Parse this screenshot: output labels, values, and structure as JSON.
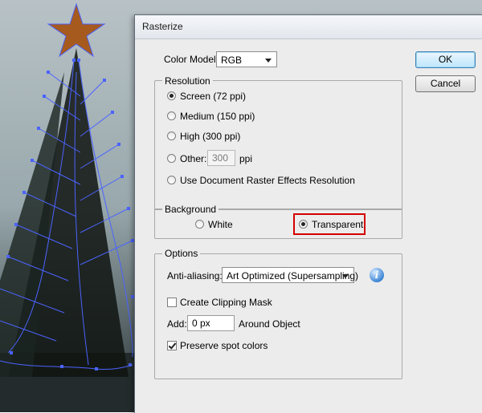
{
  "dialog": {
    "title": "Rasterize"
  },
  "color_model": {
    "label": "Color Model:",
    "value": "RGB"
  },
  "buttons": {
    "ok": "OK",
    "cancel": "Cancel"
  },
  "resolution": {
    "title": "Resolution",
    "options": [
      "Screen (72 ppi)",
      "Medium (150 ppi)",
      "High (300 ppi)",
      "Other:",
      "Use Document Raster Effects Resolution"
    ],
    "selected": "Screen (72 ppi)",
    "other_value": "300",
    "other_unit": "ppi"
  },
  "background": {
    "title": "Background",
    "white": "White",
    "transparent": "Transparent",
    "selected": "Transparent"
  },
  "options": {
    "title": "Options",
    "anti_aliasing_label": "Anti-aliasing:",
    "anti_aliasing_value": "Art Optimized (Supersampling)",
    "clipping_mask": "Create Clipping Mask",
    "clipping_mask_checked": false,
    "add_label": "Add:",
    "add_value": "0 px",
    "around_object": "Around Object",
    "preserve_spot": "Preserve spot colors",
    "preserve_spot_checked": true
  },
  "colors": {
    "highlight": "#d40000",
    "star": "#a65a1e",
    "path": "#4b63ff"
  }
}
